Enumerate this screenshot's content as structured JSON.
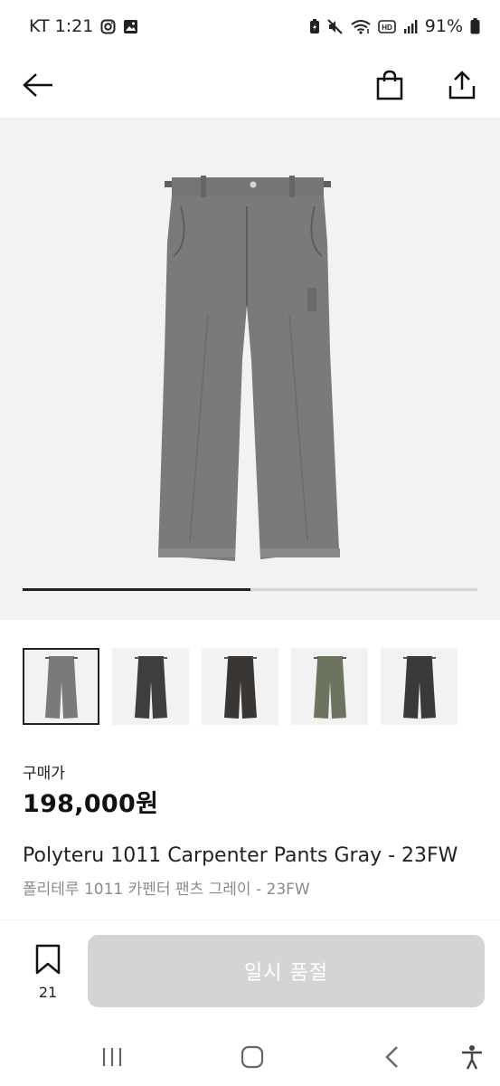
{
  "status_bar": {
    "carrier_time": "KT 1:21",
    "battery": "91%",
    "icons": [
      "instagram-icon",
      "gallery-icon",
      "battery-saver-icon",
      "mute-icon",
      "wifi-icon",
      "hd-icon",
      "signal-icon",
      "battery-icon"
    ]
  },
  "app_bar": {
    "icons": [
      "back-arrow-icon",
      "shopping-bag-icon",
      "share-icon"
    ]
  },
  "gallery": {
    "progress": 0.5,
    "thumbnails": [
      {
        "color": "#7a7a7a",
        "selected": true
      },
      {
        "color": "#3e3e40",
        "selected": false
      },
      {
        "color": "#3a3634",
        "selected": false
      },
      {
        "color": "#6c7460",
        "selected": false
      },
      {
        "color": "#3a3a3c",
        "selected": false
      }
    ]
  },
  "product": {
    "price_label": "구매가",
    "price": "198,000원",
    "title_en": "Polyteru 1011 Carpenter Pants Gray - 23FW",
    "title_ko": "폴리테루 1011 카펜터 팬츠 그레이 - 23FW"
  },
  "action_bar": {
    "wish_count": "21",
    "button_label": "일시 품절",
    "button_color": "#d4d4d4"
  },
  "system_nav": {
    "icons": [
      "recent-apps-icon",
      "home-icon",
      "back-icon",
      "accessibility-icon"
    ]
  }
}
